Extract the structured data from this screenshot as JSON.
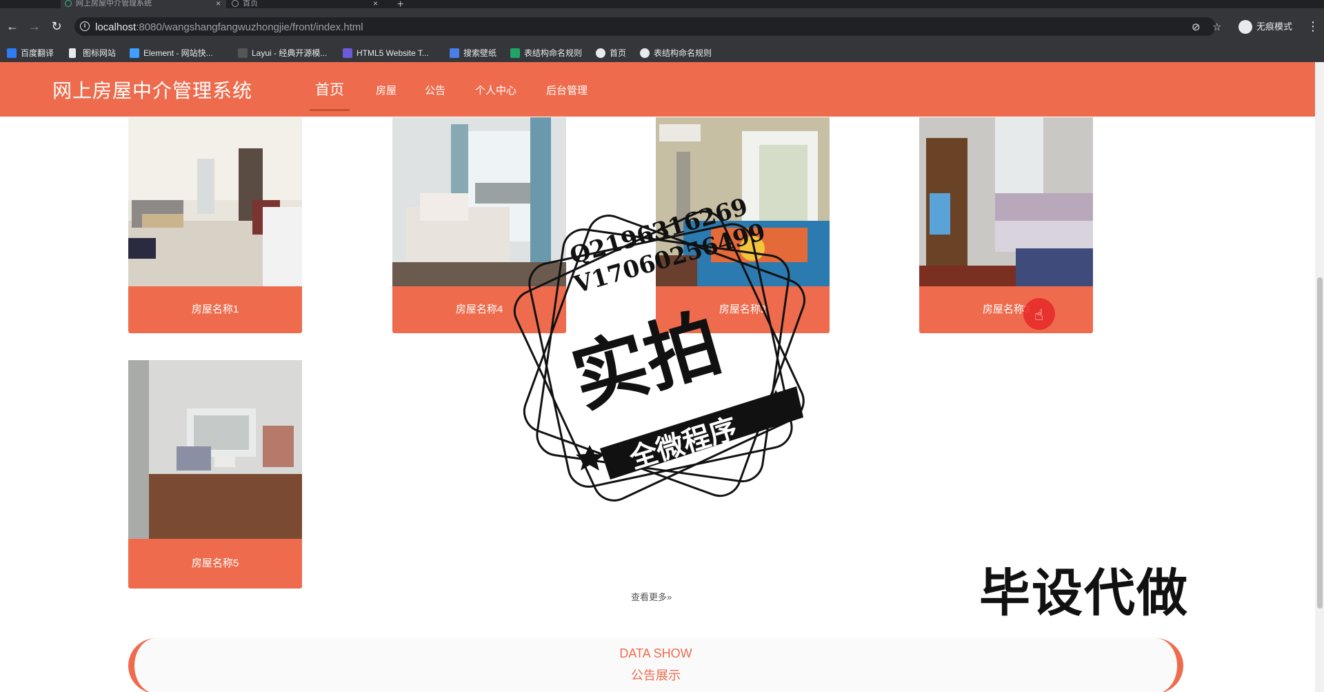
{
  "browser": {
    "tabs": [
      {
        "title": "网上房屋中介管理系统"
      },
      {
        "title": "首页"
      }
    ],
    "url_host": "localhost",
    "url_rest": ":8080/wangshangfangwuzhongjie/front/index.html",
    "profile_label": "无痕模式",
    "bookmarks": [
      {
        "label": "百度翻译",
        "color": "#2f7bf6"
      },
      {
        "label": "图标网站",
        "color": "#ffffff"
      },
      {
        "label": "Element - 网站快...",
        "color": "#409eff"
      },
      {
        "label": "Layui - 经典开源模...",
        "color": "#e8eaed"
      },
      {
        "label": "HTML5 Website T...",
        "color": "#6b5bd8"
      },
      {
        "label": "搜索壁纸",
        "color": "#4a7de8"
      },
      {
        "label": "表结构命名规则",
        "color": "#21a366"
      },
      {
        "label": "首页",
        "color": "#e8eaed"
      },
      {
        "label": "表结构命名规则",
        "color": "#e8eaed"
      }
    ]
  },
  "site": {
    "brand": "网上房屋中介管理系统",
    "accent": "#ee6c4d",
    "nav": [
      {
        "label": "首页",
        "active": true
      },
      {
        "label": "房屋"
      },
      {
        "label": "公告"
      },
      {
        "label": "个人中心"
      },
      {
        "label": "后台管理"
      }
    ]
  },
  "listings": [
    {
      "name": "房屋名称1"
    },
    {
      "name": "房屋名称4"
    },
    {
      "name": "房屋名称2"
    },
    {
      "name": "房屋名称3"
    },
    {
      "name": "房屋名称5"
    }
  ],
  "more_label": "查看更多",
  "more_icon": "double-chevron-right",
  "data_show": {
    "title_en": "DATA SHOW",
    "title_cn": "公告展示"
  },
  "watermark": {
    "line1": "Q2196316269",
    "line2": "V17060256499",
    "main": "实拍",
    "band": "全微程序",
    "corner_text": "毕设代做"
  }
}
